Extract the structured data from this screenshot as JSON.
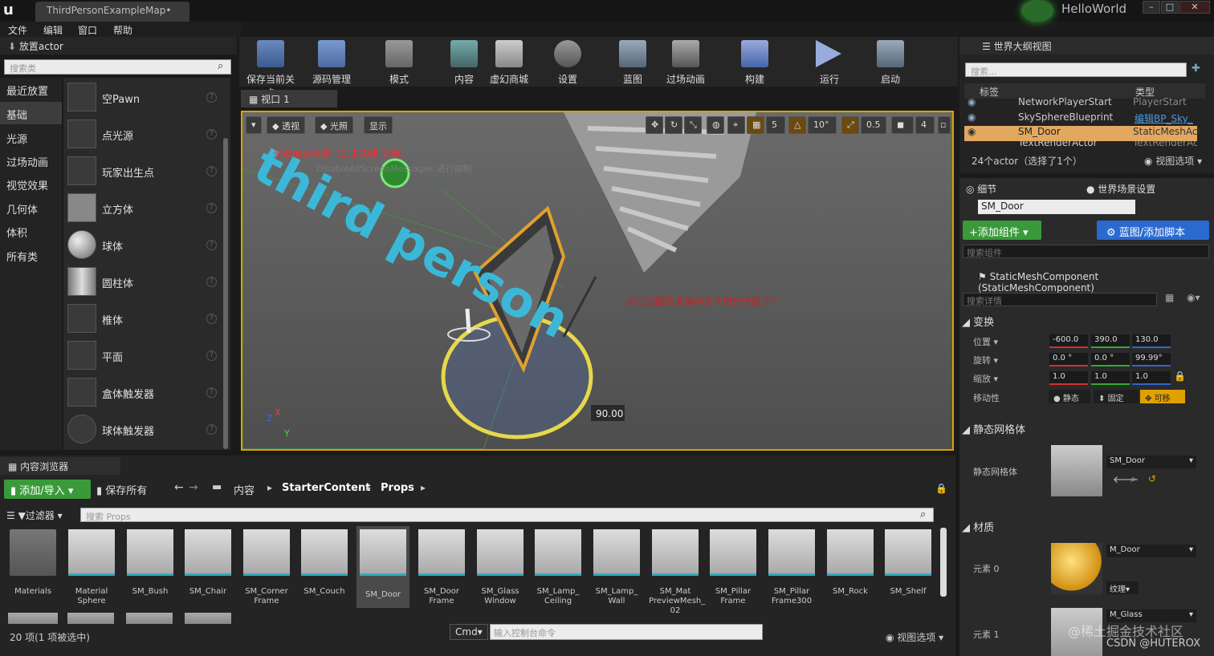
{
  "window": {
    "tab_title": "ThirdPersonExampleMap•",
    "project": "HelloWorld",
    "logo": "u"
  },
  "menu": [
    "文件",
    "编辑",
    "窗口",
    "帮助"
  ],
  "place_actor": {
    "title": "放置actor",
    "search_placeholder": "搜索类",
    "categories": [
      "最近放置",
      "基础",
      "光源",
      "过场动画",
      "视觉效果",
      "几何体",
      "体积",
      "所有类"
    ],
    "selected_category": "基础",
    "items": [
      "空Pawn",
      "点光源",
      "玩家出生点",
      "立方体",
      "球体",
      "圆柱体",
      "椎体",
      "平面",
      "盒体触发器",
      "球体触发器"
    ]
  },
  "toolbar": [
    "保存当前关卡",
    "源码管理",
    "模式",
    "内容",
    "虚幻商城",
    "设置",
    "蓝图",
    "过场动画",
    "构建",
    "运行",
    "启动"
  ],
  "viewport": {
    "tab": "视口 1",
    "buttons": [
      "透视",
      "光照",
      "显示"
    ],
    "snap": {
      "grid": "5",
      "rotation": "10°",
      "scale": "0.5",
      "camera_speed": "4"
    },
    "warning": "光照需要重建（1 未构建 对象）",
    "warning_sub": "DisableAllScreenMessages 进行抑制",
    "world_text": "third person",
    "red_text": "对已加载的未保存关卡进行修改了？",
    "angle": "90.00"
  },
  "outliner": {
    "title": "世界大纲视图",
    "search_placeholder": "搜索...",
    "col_label": "标签",
    "col_type": "类型",
    "rows": [
      {
        "label": "NetworkPlayerStart",
        "type": "PlayerStart"
      },
      {
        "label": "SkySphereBlueprint",
        "type": "编辑BP_Sky_"
      },
      {
        "label": "SM_Door",
        "type": "StaticMeshAct"
      },
      {
        "label": "TextRenderActor",
        "type": "TextRenderAct"
      }
    ],
    "count": "24个actor（选择了1个）",
    "view_options": "视图选项"
  },
  "details": {
    "tab1": "细节",
    "tab2": "世界场景设置",
    "name": "SM_Door",
    "add_component": "+添加组件",
    "blueprint_btn": "蓝图/添加脚本",
    "search_component": "搜索组件",
    "component": "StaticMeshComponent (StaticMeshComponent)",
    "search_details": "搜索详情",
    "transform": "变换",
    "location_label": "位置",
    "rotation_label": "旋转",
    "scale_label": "缩放",
    "mobility_label": "移动性",
    "location": [
      "-600.0",
      "390.0",
      "130.0"
    ],
    "rotation": [
      "0.0 °",
      "0.0 °",
      "99.99°"
    ],
    "scale": [
      "1.0",
      "1.0",
      "1.0"
    ],
    "mobility": [
      "静态",
      "固定",
      "可移"
    ],
    "static_mesh_section": "静态网格体",
    "static_mesh_label": "静态网格体",
    "static_mesh_value": "SM_Door",
    "material_section": "材质",
    "element0": "元素 0",
    "element0_value": "M_Door",
    "texture_btn": "纹理",
    "element1": "元素 1",
    "element1_value": "M_Glass"
  },
  "content_browser": {
    "title": "内容浏览器",
    "add_import": "添加/导入",
    "save_all": "保存所有",
    "crumbs": [
      "内容",
      "StarterContent",
      "Props"
    ],
    "filter": "过滤器",
    "search_placeholder": "搜索 Props",
    "assets": [
      "Materials",
      "Material Sphere",
      "SM_Bush",
      "SM_Chair",
      "SM_Corner Frame",
      "SM_Couch",
      "SM_Door",
      "SM_Door Frame",
      "SM_Glass Window",
      "SM_Lamp_ Ceiling",
      "SM_Lamp_ Wall",
      "SM_Mat PreviewMesh_ 02",
      "SM_Pillar Frame",
      "SM_Pillar Frame300",
      "SM_Rock",
      "SM_Shelf"
    ],
    "status": "20 项(1 项被选中)",
    "cmd": "Cmd",
    "console_placeholder": "输入控制台命令",
    "view_options": "视图选项"
  },
  "watermark": "@稀土掘金技术社区",
  "watermark2": "CSDN @HUTEROX"
}
